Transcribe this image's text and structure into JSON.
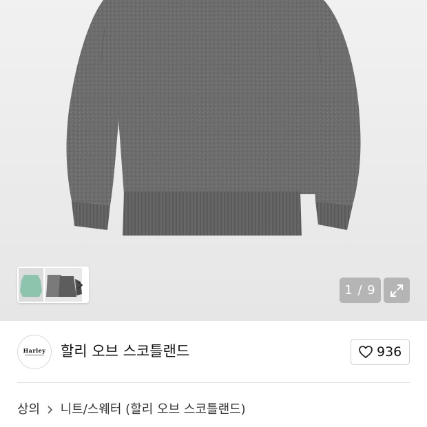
{
  "gallery": {
    "current_page": "1",
    "separator": "/",
    "total_pages": "9",
    "thumbnails": [
      "mint-sweater-thumbnail",
      "grey-sweaters-thumbnail"
    ]
  },
  "brand": {
    "logo_text": "Harley",
    "name": "할리 오브 스코틀랜드"
  },
  "like": {
    "count": "936"
  },
  "breadcrumb": {
    "items": [
      "상의",
      "니트/스웨터 (할리 오브 스코틀랜드)"
    ]
  },
  "colors": {
    "sweater": "#6b6b6b",
    "background": "#ececec",
    "overlay": "#8a8a8a"
  }
}
